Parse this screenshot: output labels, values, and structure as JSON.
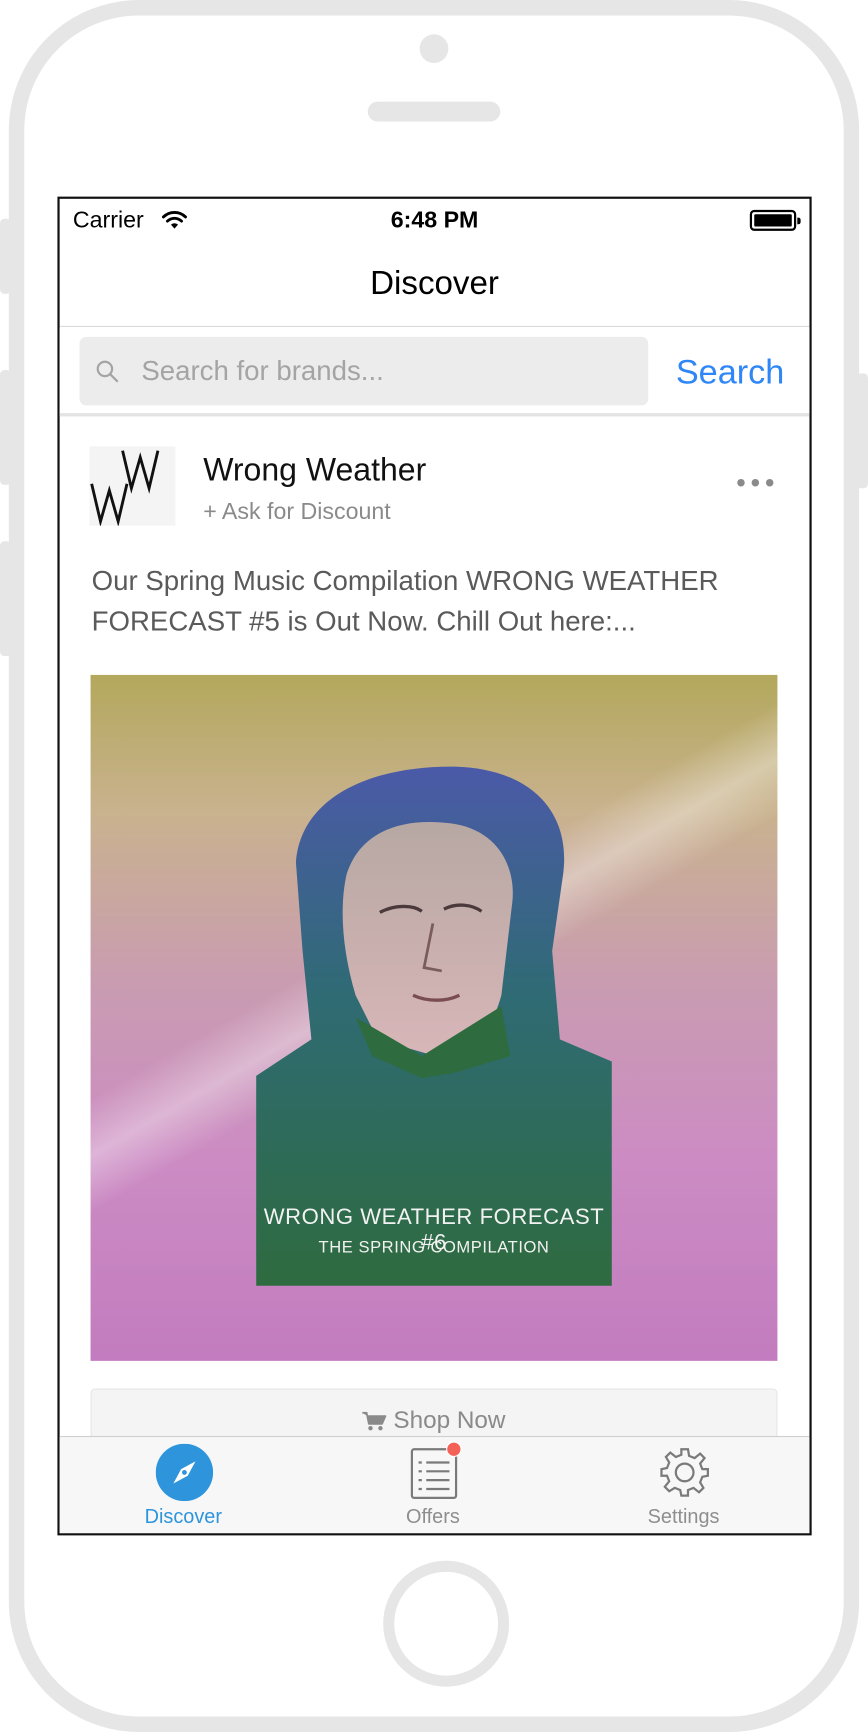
{
  "status_bar": {
    "carrier": "Carrier",
    "time": "6:48 PM"
  },
  "nav": {
    "title": "Discover"
  },
  "search": {
    "placeholder": "Search for brands...",
    "value": "",
    "button_label": "Search"
  },
  "post": {
    "brand_name": "Wrong Weather",
    "discount_label": "+ Ask for Discount",
    "text": "Our Spring Music Compilation WRONG WEATHER FORECAST #5 is Out Now. Chill Out here:...",
    "image_title": "WRONG WEATHER FORECAST #6",
    "image_subtitle": "THE SPRING COMPILATION",
    "shop_label": "Shop Now"
  },
  "tabs": [
    {
      "label": "Discover",
      "icon": "compass-icon",
      "active": true
    },
    {
      "label": "Offers",
      "icon": "list-icon",
      "badge": true
    },
    {
      "label": "Settings",
      "icon": "gear-icon"
    }
  ],
  "colors": {
    "accent": "#2f86f6",
    "tab_active": "#2e95dc",
    "badge": "#f36157"
  }
}
